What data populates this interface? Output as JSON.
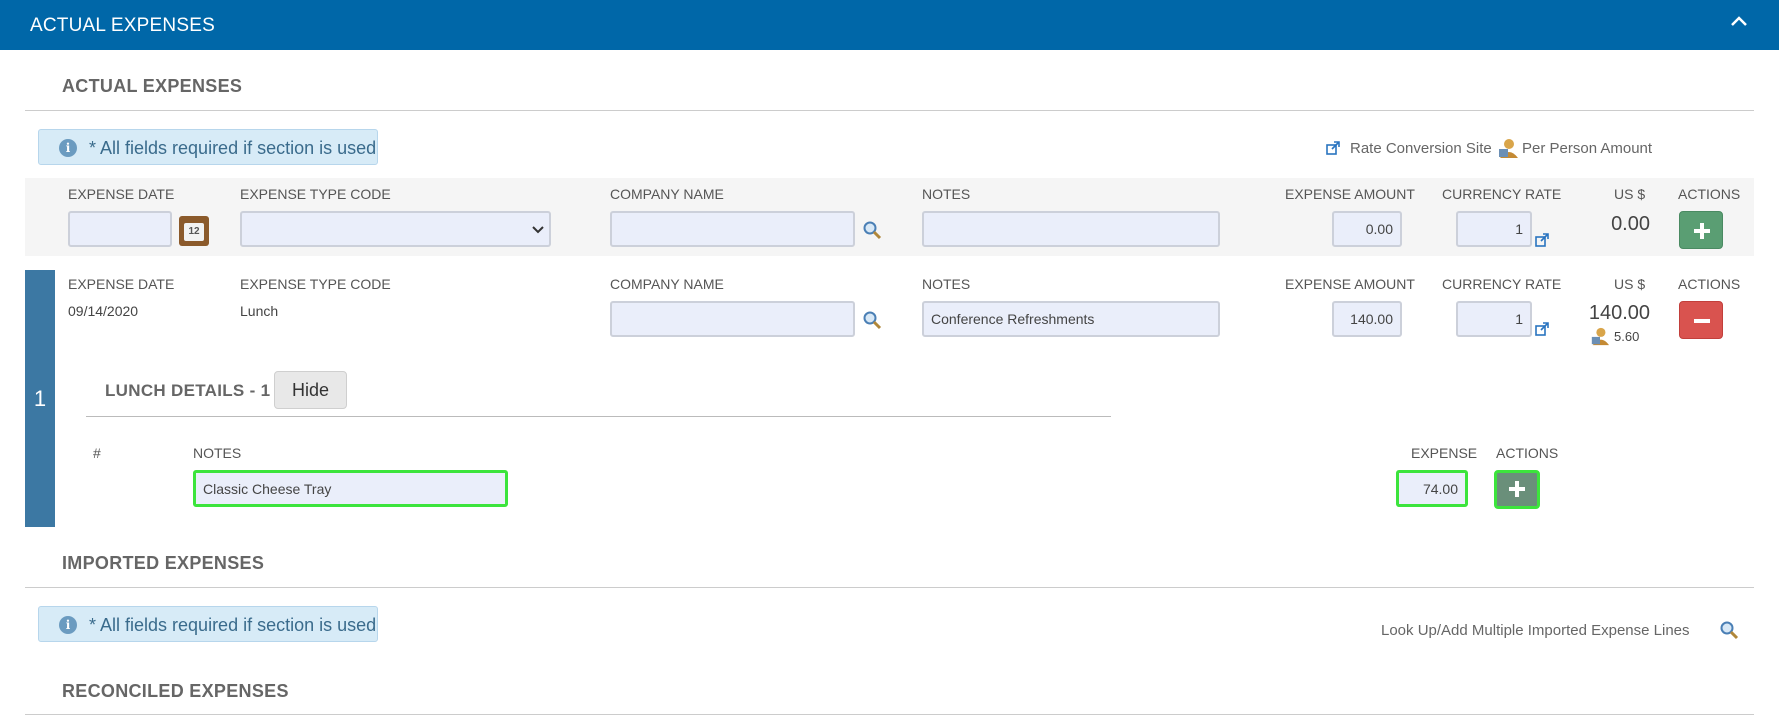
{
  "header": {
    "title": "ACTUAL EXPENSES"
  },
  "actual": {
    "section_title": "ACTUAL EXPENSES",
    "info_text": "* All fields required if section is used",
    "links": {
      "rate_conversion": "Rate Conversion Site",
      "per_person": "Per Person Amount"
    },
    "columns": {
      "expense_date": "EXPENSE DATE",
      "expense_type": "EXPENSE TYPE CODE",
      "company_name": "COMPANY NAME",
      "notes": "NOTES",
      "expense_amount": "EXPENSE AMOUNT",
      "currency_rate": "CURRENCY RATE",
      "usd": "US $",
      "actions": "ACTIONS"
    },
    "new_row": {
      "expense_date": "",
      "expense_type": "",
      "company_name": "",
      "notes": "",
      "expense_amount": "0.00",
      "currency_rate": "1",
      "usd": "0.00"
    },
    "line1": {
      "number": "1",
      "expense_date": "09/14/2020",
      "expense_type": "Lunch",
      "company_name": "",
      "notes": "Conference Refreshments",
      "expense_amount": "140.00",
      "currency_rate": "1",
      "usd": "140.00",
      "per_person": "5.60",
      "details": {
        "title": "LUNCH DETAILS - 1",
        "hide_label": "Hide",
        "col_num": "#",
        "col_notes": "NOTES",
        "col_expense": "EXPENSE",
        "col_actions": "ACTIONS",
        "notes_value": "Classic Cheese Tray",
        "expense_value": "74.00"
      }
    }
  },
  "imported": {
    "section_title": "IMPORTED EXPENSES",
    "info_text": "* All fields required if section is used",
    "lookup_link": "Look Up/Add Multiple Imported Expense Lines"
  },
  "reconciled": {
    "section_title": "RECONCILED EXPENSES"
  },
  "colors": {
    "header_bg": "#0067a8",
    "add_green": "#5a9e73",
    "remove_red": "#d9534f",
    "line_band": "#3c78a3",
    "highlight": "#3ce43c"
  }
}
